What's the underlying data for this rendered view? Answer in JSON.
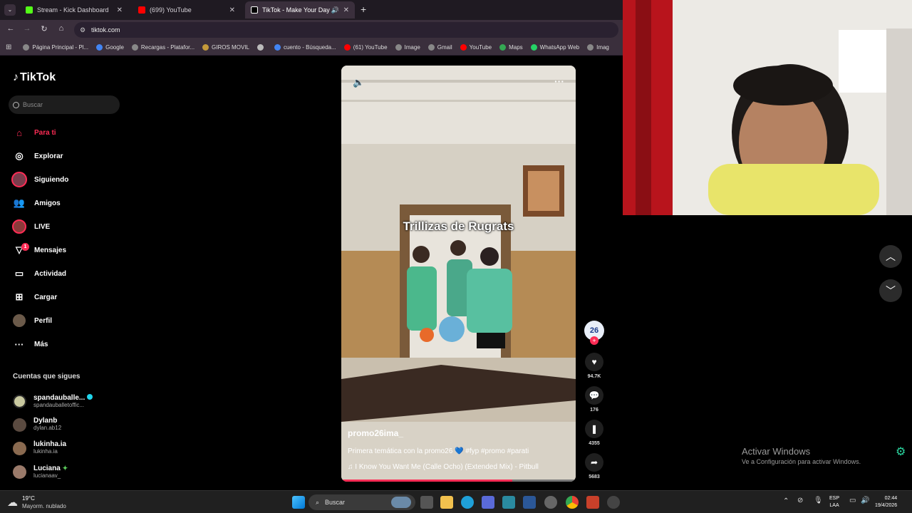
{
  "browser": {
    "tabs": [
      {
        "title": "Stream - Kick Dashboard",
        "color": "#53fc18"
      },
      {
        "title": "(699) YouTube",
        "color": "#ff0000"
      },
      {
        "title": "TikTok - Make Your Day",
        "color": "#ffffff"
      }
    ],
    "url": "tiktok.com",
    "bookmarks": [
      {
        "label": "Página Principal - Pl...",
        "color": "#888888"
      },
      {
        "label": "Google",
        "color": "#4285f4"
      },
      {
        "label": "Recargas - Platafor...",
        "color": "#888888"
      },
      {
        "label": "GIROS MOVIL",
        "color": "#c49a3a"
      },
      {
        "label": "",
        "color": "#bbbbbb"
      },
      {
        "label": "cuento - Búsqueda...",
        "color": "#4285f4"
      },
      {
        "label": "(61) YouTube",
        "color": "#ff0000"
      },
      {
        "label": "Image",
        "color": "#888888"
      },
      {
        "label": "Gmail",
        "color": "#888888"
      },
      {
        "label": "YouTube",
        "color": "#ff0000"
      },
      {
        "label": "Maps",
        "color": "#34a853"
      },
      {
        "label": "WhatsApp Web",
        "color": "#25d366"
      },
      {
        "label": "Imag",
        "color": "#888888"
      }
    ]
  },
  "tiktok": {
    "logo": "TikTok",
    "search_placeholder": "Buscar",
    "nav": [
      {
        "label": "Para ti",
        "icon": "home-icon"
      },
      {
        "label": "Explorar",
        "icon": "compass-icon"
      },
      {
        "label": "Siguiendo",
        "icon": "following-avatar-icon"
      },
      {
        "label": "Amigos",
        "icon": "friends-icon"
      },
      {
        "label": "LIVE",
        "icon": "live-icon"
      },
      {
        "label": "Mensajes",
        "icon": "messages-icon"
      },
      {
        "label": "Actividad",
        "icon": "activity-icon"
      },
      {
        "label": "Cargar",
        "icon": "upload-icon"
      },
      {
        "label": "Perfil",
        "icon": "profile-icon"
      },
      {
        "label": "Más",
        "icon": "more-icon"
      }
    ],
    "messages_badge": "1",
    "following_title": "Cuentas que sigues",
    "following": [
      {
        "name": "spandauballe...",
        "handle": "spandauballetoffic...",
        "color": "#c9c9a0"
      },
      {
        "name": "Dylanb",
        "handle": "dylan.ab12",
        "color": "#5a4a40"
      },
      {
        "name": "lukinha.ia",
        "handle": "lukinha.ia",
        "color": "#8a6a50"
      },
      {
        "name": "Luciana",
        "handle": "lucianaav_",
        "color": "#9a7a6a"
      }
    ]
  },
  "video": {
    "overlay_title": "Trillizas de Rugrats",
    "username": "promo26ima_",
    "caption": "Primera temática con la promo26 💙 #fyp #promo #parati",
    "music": "I Know You Want Me (Calle Ocho) (Extended Mix) - Pitbull",
    "progress": 0.73
  },
  "actions": {
    "avatar_text": "26",
    "likes": "94.7K",
    "comments": "176",
    "saves": "4355",
    "shares": "5683"
  },
  "watermark": {
    "line1": "Activar Windows",
    "line2": "Ve a Configuración para activar Windows."
  },
  "taskbar": {
    "temperature": "19°C",
    "weather": "Mayorm. nublado",
    "search": "Buscar",
    "lang1": "ESP",
    "lang2": "LAA",
    "time": "02:44",
    "date": "19/4/2026"
  }
}
